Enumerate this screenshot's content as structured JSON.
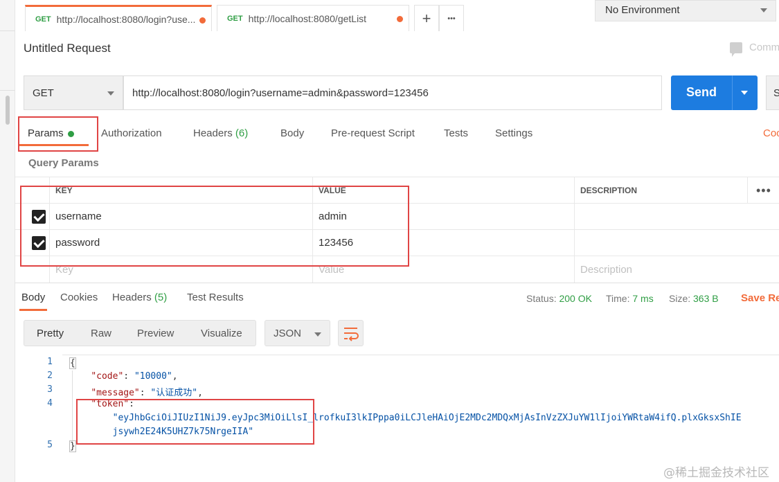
{
  "tabs": [
    {
      "method": "GET",
      "url": "http://localhost:8080/login?use...",
      "unsaved": true
    },
    {
      "method": "GET",
      "url": "http://localhost:8080/getList",
      "unsaved": true
    }
  ],
  "tab_actions": {
    "new_tab": "+",
    "more": "•••"
  },
  "environment": {
    "selected": "No Environment"
  },
  "request": {
    "title": "Untitled Request",
    "comments_label": "Comm",
    "method": "GET",
    "url": "http://localhost:8080/login?username=admin&password=123456",
    "send_label": "Send",
    "save_label": "S"
  },
  "request_tabs": {
    "params": "Params",
    "authorization": "Authorization",
    "headers": "Headers",
    "headers_count": "(6)",
    "body": "Body",
    "pre_request": "Pre-request Script",
    "tests": "Tests",
    "settings": "Settings",
    "cookies_edge": "Coo"
  },
  "query_params": {
    "label": "Query Params",
    "columns": {
      "key": "KEY",
      "value": "VALUE",
      "description": "DESCRIPTION"
    },
    "rows": [
      {
        "checked": true,
        "key": "username",
        "value": "admin"
      },
      {
        "checked": true,
        "key": "password",
        "value": "123456"
      }
    ],
    "placeholders": {
      "key": "Key",
      "value": "Value",
      "description": "Description"
    }
  },
  "response_tabs": {
    "body": "Body",
    "cookies": "Cookies",
    "headers": "Headers",
    "headers_count": "(5)",
    "test_results": "Test Results"
  },
  "response_meta": {
    "status_label": "Status:",
    "status": "200 OK",
    "time_label": "Time:",
    "time": "7 ms",
    "size_label": "Size:",
    "size": "363 B",
    "save_response": "Save Re"
  },
  "view": {
    "pretty": "Pretty",
    "raw": "Raw",
    "preview": "Preview",
    "visualize": "Visualize",
    "format": "JSON"
  },
  "code": {
    "line_numbers": [
      "1",
      "2",
      "3",
      "4",
      "5"
    ],
    "open_brace": "{",
    "close_brace": "}",
    "code_key": "\"code\"",
    "code_value": "\"10000\"",
    "message_key": "\"message\"",
    "message_value": "\"认证成功\"",
    "token_key": "\"token\"",
    "token_value_line1": "\"eyJhbGciOiJIUzI1NiJ9.eyJpc3MiOiLlsI_lrofkuI3lkIPppa0iLCJleHAiOjE2MDc2MDQxMjAsInVzZXJuYW1lIjoiYWRtaW4ifQ.plxGksxShIE",
    "token_value_line2": "jsywh2E24K5UHZ7k75NrgeIIA\""
  },
  "watermark": "@稀土掘金技术社区",
  "colors": {
    "accent": "#f26b3a",
    "primary": "#1d7ce0",
    "success": "#2f9e44",
    "annotation": "#e04444"
  }
}
